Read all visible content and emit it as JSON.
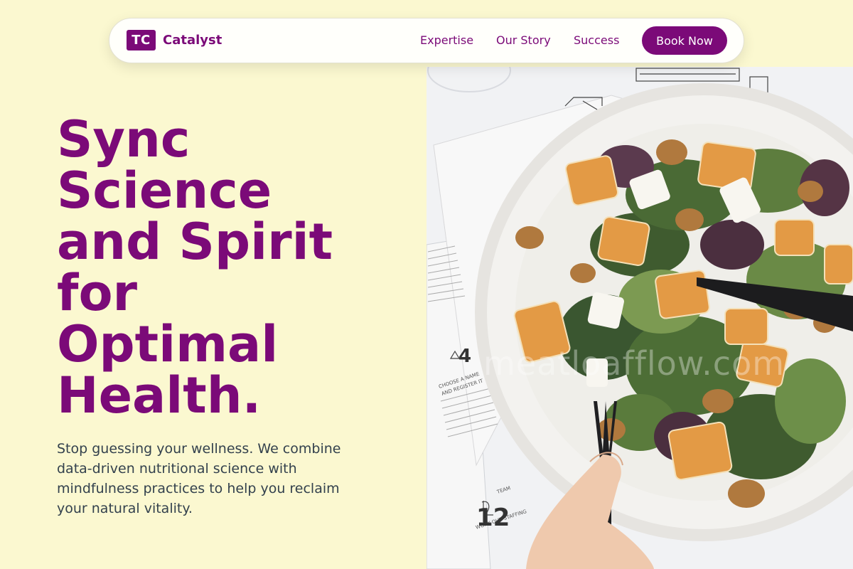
{
  "nav": {
    "brand_mark": "TC",
    "brand_name": "Catalyst",
    "links": [
      "Expertise",
      "Our Story",
      "Success"
    ],
    "cta_label": "Book Now"
  },
  "hero": {
    "headline_lines": [
      "Sync",
      "Science",
      "and Spirit",
      "for",
      "Optimal",
      "Health."
    ],
    "subcopy": "Stop guessing your wellness. We combine data-driven nutritional science with mindfulness practices to help you reclaim your natural vitality.",
    "image_watermark": "meatloafflow.com"
  },
  "colors": {
    "page_bg": "#fbf8d0",
    "brand_purple": "#7b0a78",
    "body_text": "#33414d"
  }
}
